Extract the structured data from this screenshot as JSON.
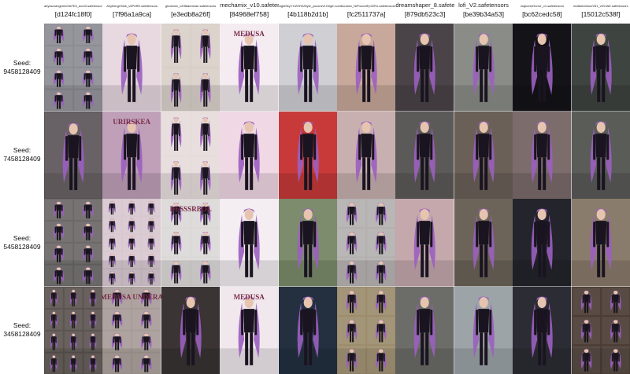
{
  "columns": [
    {
      "model": "abyssorangemixSAFE0_aom3.safetensors",
      "hash": "[d124fc18f0]"
    },
    {
      "model": "AnythingV5Ink_v5PrtRE.safetensors",
      "hash": "[7f96a1a9ca]"
    },
    {
      "model": "ghostmix_v20Bakedvae.safetensors",
      "hash": "[e3edb8a26f]"
    },
    {
      "model": "mechamix_v10.safetensors",
      "hash": "[84968ef758]"
    },
    {
      "model": "nightSkyYOZORAStyle_yozoraV1Origin.safetensors",
      "hash": "[4b118b2d1b]"
    },
    {
      "model": "chilloutmix_NiPrunedFp32Fix.safetensors",
      "hash": "[fc2511737a]"
    },
    {
      "model": "dreamshaper_8.safetensors",
      "hash": "[879db523c3]"
    },
    {
      "model": "lofi_V2.safetensors",
      "hash": "[be39b34a53]"
    },
    {
      "model": "majicmixHorror_v1.safetensors",
      "hash": "[bc62cedc58]"
    },
    {
      "model": "realisticVisionV51_v51VAE.safetensors",
      "hash": "[15012c538f]"
    }
  ],
  "rows": [
    {
      "label": "Seed:",
      "seed": "9458128409"
    },
    {
      "label": "Seed:",
      "seed": "7458128409"
    },
    {
      "label": "Seed:",
      "seed": "5458128409"
    },
    {
      "label": "Seed:",
      "seed": "3458128409"
    }
  ],
  "image_text": {
    "r1c4": "MEDUSA",
    "r2c2": "URIRSKEA",
    "r3c3": "DESSSRBOL",
    "r4c2": "MEDUSA UNDERA",
    "r4c4": "MEDUSA"
  },
  "colors": {
    "hair": "#9b5fc0",
    "outfit": "#1a1420",
    "skin": "#e6c4b0"
  }
}
